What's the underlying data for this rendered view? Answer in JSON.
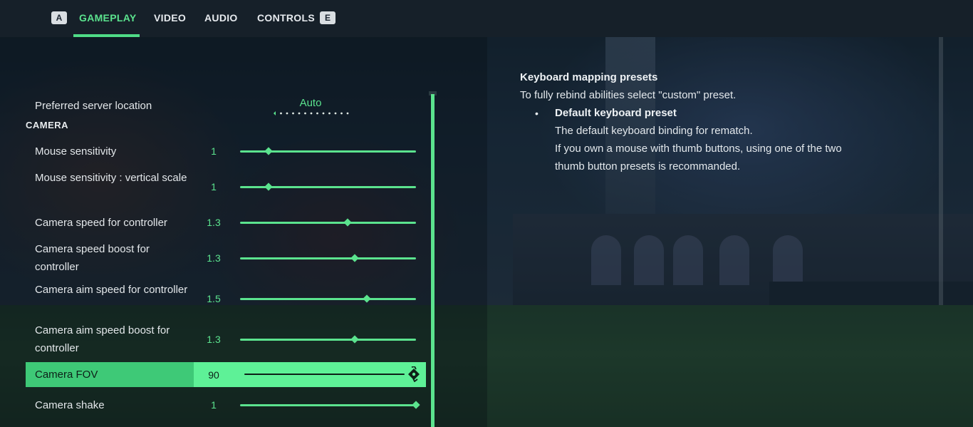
{
  "nav": {
    "left_key": "A",
    "right_key": "E",
    "tabs": [
      {
        "label": "GAMEPLAY",
        "active": true
      },
      {
        "label": "VIDEO",
        "active": false
      },
      {
        "label": "AUDIO",
        "active": false
      },
      {
        "label": "CONTROLS",
        "active": false
      }
    ]
  },
  "settings": {
    "server": {
      "label": "Preferred server location",
      "value": "Auto",
      "option_count": 13
    },
    "section": "CAMERA",
    "rows": [
      {
        "label": "Mouse sensitivity",
        "value": "1",
        "level": 0.16
      },
      {
        "label": "Mouse sensitivity : vertical scale",
        "value": "1",
        "level": 0.16
      },
      {
        "label": "Camera speed for controller",
        "value": "1.3",
        "level": 0.61
      },
      {
        "label": "Camera speed boost for controller",
        "value": "1.3",
        "level": 0.65
      },
      {
        "label": "Camera aim speed for controller",
        "value": "1.5",
        "level": 0.72
      },
      {
        "label": "Camera aim speed boost for controller",
        "value": "1.3",
        "level": 0.65
      },
      {
        "label": "Camera FOV",
        "value": "90",
        "level": 1.0,
        "selected": true
      },
      {
        "label": "Camera shake",
        "value": "1",
        "level": 1.0
      }
    ]
  },
  "description": {
    "title": "Keyboard mapping presets",
    "text": "To fully rebind abilities select \"custom\" preset.",
    "bullet": {
      "title": "Default keyboard preset",
      "lines": [
        "The default keyboard binding for rematch.",
        "If you own a mouse with thumb buttons, using one of the two",
        "thumb button presets is recommanded."
      ]
    }
  },
  "colors": {
    "accent": "#5be38e",
    "selected_row": "#3ec977",
    "selected_value": "#5ef197",
    "topbar": "#162029"
  }
}
